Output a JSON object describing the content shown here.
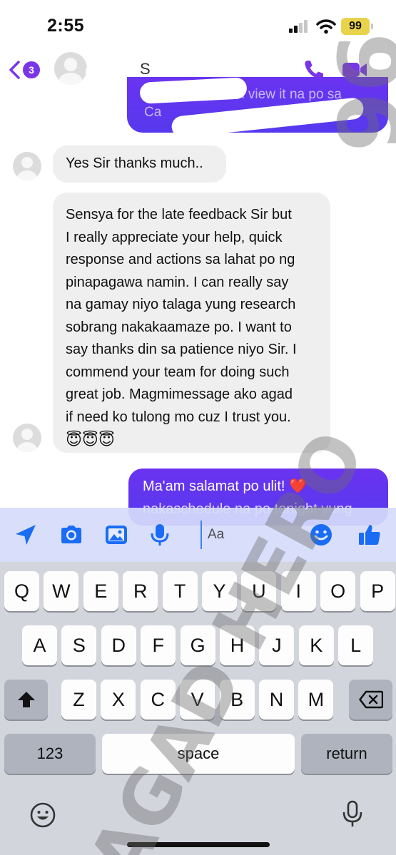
{
  "status_bar": {
    "time": "2:55",
    "battery": "99"
  },
  "header": {
    "back_count": "3",
    "icons": [
      "back-chevron-icon",
      "phone-icon",
      "video-camera-icon"
    ],
    "accent_color": "#7a35e8",
    "partial_text_1": "S",
    "partial_text_2": "can view it na po sa",
    "partial_text_3": "Ca"
  },
  "conversation": {
    "incoming_color": "#efefef",
    "outgoing_color": "#5a35ee",
    "messages": [
      {
        "direction": "incoming",
        "text": "Yes Sir thanks much.."
      },
      {
        "direction": "incoming",
        "lines": [
          "Sensya for the late feedback Sir but",
          "I really appreciate your help, quick",
          "response and actions sa lahat po ng",
          "pinapagawa namin. I can really say",
          "na gamay niyo talaga yung research",
          "sobrang nakakaamaze po. I want to",
          "say thanks din sa patience niyo Sir. I",
          "commend your team for doing such",
          "great job. Magmimessage ako agad",
          "if need ko tulong mo cuz I trust you.",
          "😇😇😇"
        ]
      },
      {
        "direction": "outgoing",
        "text": "Ma'am salamat po ulit! ❤️",
        "partial_text": "nakaschedule na po tonight yung"
      }
    ]
  },
  "composer": {
    "placeholder": "Aa",
    "icons": [
      "send-arrow-icon",
      "camera-icon",
      "photo-icon",
      "microphone-icon",
      "emoji-icon",
      "thumbs-up-icon"
    ]
  },
  "keyboard": {
    "row1": [
      "Q",
      "W",
      "E",
      "R",
      "T",
      "Y",
      "U",
      "I",
      "O",
      "P"
    ],
    "row2": [
      "A",
      "S",
      "D",
      "F",
      "G",
      "H",
      "J",
      "K",
      "L"
    ],
    "row3": [
      "Z",
      "X",
      "C",
      "V",
      "B",
      "N",
      "M"
    ],
    "numbers_label": "123",
    "space_label": "space",
    "return_label": "return"
  },
  "watermark": {
    "text": "AGAD HERO",
    "number": "96"
  }
}
